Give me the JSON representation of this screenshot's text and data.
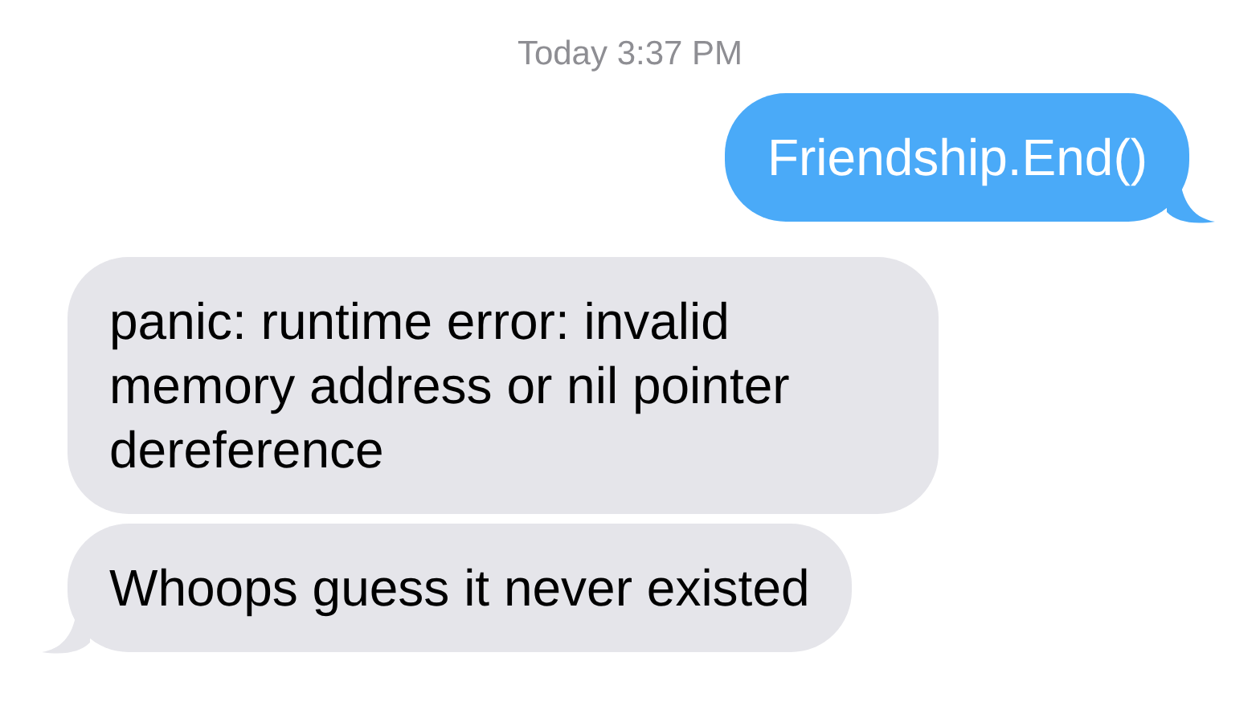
{
  "timestamp": "Today 3:37 PM",
  "messages": [
    {
      "kind": "sent",
      "text": "Friendship.End()",
      "tail": true
    },
    {
      "kind": "received",
      "text": "panic: runtime error: invalid memory address or nil pointer dereference",
      "tail": false
    },
    {
      "kind": "received",
      "text": "Whoops guess it never existed",
      "tail": true
    }
  ]
}
